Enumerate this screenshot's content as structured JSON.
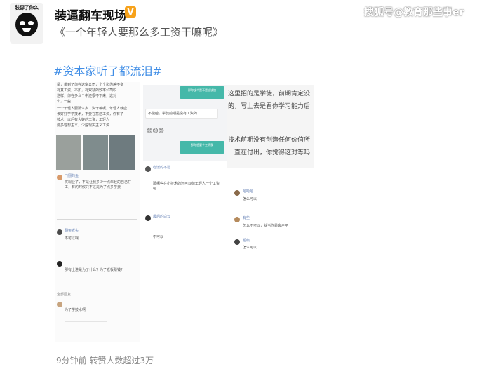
{
  "post": {
    "avatar_caption": "裝孬了你么",
    "author": "装逼翻车现场",
    "verified_badge": "V",
    "watermark": "搜狐号@教育那些事er",
    "text": "《一个年轻人要那么多工资干嘛呢》",
    "hashtag": "#资本家听了都流泪#",
    "footer": "9分钟前  转赞人数超过3万"
  },
  "collage": {
    "panel1": {
      "lines": [
        "是，做到了你在这家公司，个个和你差不多",
        "有真工资，不如，有双钱的效率公司职",
        "这样，你在多么个中还很不下来，这对",
        "个，一些",
        "一个年轻人要那么多工资干嘛呢，年轻人就应",
        "该好好学学技术，不要在意这工资，你有了",
        "技术，以后有大好的工资，年轻人",
        "要多理想主义，少些现实主义工资"
      ],
      "comment1_user": "飞翔的鱼",
      "comment1_text": "实现业了，不是让我多少一点年轻的自己打工，有的时候只不过是为了点多学费",
      "comment2_user": "翻鱼老头",
      "comment2_text": "不可以啊",
      "comment3_text": "那有上进是为了什么？为了老板赚钱?",
      "comment4_text": "为了学技术啊",
      "tag": "全部回复"
    },
    "panel2": {
      "bubble1": "那你这个是不是应该加",
      "text1": "不能给，学徒前期是没有工资的",
      "emoji": "😊😊😊",
      "bubble2": "那你想要个工资我",
      "c1_user": "吃饭的不错",
      "c1_text": "那哪些在小技术的还可以给年轻人一个工资吧",
      "c2_user": "最后的白云",
      "c2_text": "不可以"
    },
    "panel3": {
      "line1": "这里招的是学徒，前期肯定没",
      "line2": "的，写上去是看你学习能力后",
      "line3": "技术前期没有创造任何价值所",
      "line4": "一直在付出，你觉得这对等吗",
      "r1_user": "哈哈哈",
      "r1_text": "怎么可以",
      "r2_user": "有些",
      "r2_text": "怎么不可以，就当作是客户吧",
      "r3_user": "超级",
      "r3_text": "怎么可以"
    }
  },
  "colors": {
    "hashtag": "#3f8de6",
    "verified": "#f7a21b",
    "chat_bubble": "#45b8a9"
  },
  "icons": [
    "panda-meme-avatar",
    "verified-icon"
  ]
}
